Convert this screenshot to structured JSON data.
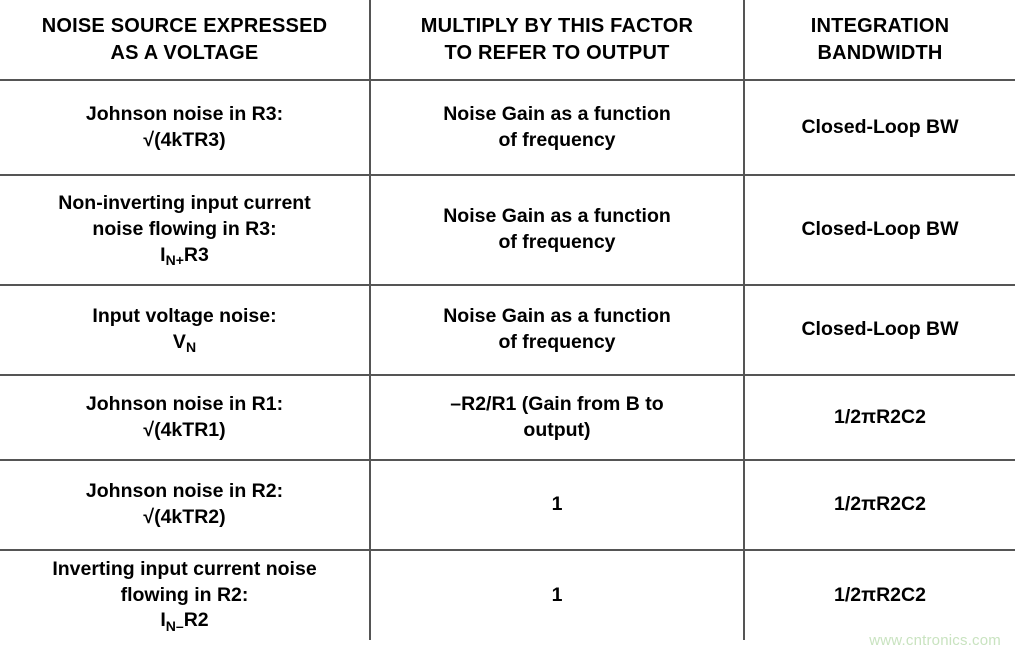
{
  "table": {
    "headers": [
      {
        "line1": "NOISE SOURCE EXPRESSED",
        "line2": "AS A VOLTAGE"
      },
      {
        "line1": "MULTIPLY BY THIS FACTOR",
        "line2": "TO REFER TO OUTPUT"
      },
      {
        "line1": "INTEGRATION",
        "line2": "BANDWIDTH"
      }
    ],
    "rows": [
      {
        "source_line1": "Johnson noise in R3:",
        "source_line2": "√(4kTR3)",
        "source_sub_base": "",
        "source_sub": "",
        "source_sub_tail": "",
        "factor_line1": "Noise Gain as a function",
        "factor_line2": "of frequency",
        "bandwidth": "Closed-Loop BW"
      },
      {
        "source_line1": "Non-inverting input current",
        "source_line2": "noise flowing in R3:",
        "source_sub_base": "I",
        "source_sub": "N+",
        "source_sub_tail": "R3",
        "factor_line1": "Noise Gain as a function",
        "factor_line2": "of frequency",
        "bandwidth": "Closed-Loop BW"
      },
      {
        "source_line1": "Input voltage noise:",
        "source_line2": "",
        "source_sub_base": "V",
        "source_sub": "N",
        "source_sub_tail": "",
        "factor_line1": "Noise Gain as a function",
        "factor_line2": "of frequency",
        "bandwidth": "Closed-Loop BW"
      },
      {
        "source_line1": "Johnson noise in R1:",
        "source_line2": "√(4kTR1)",
        "source_sub_base": "",
        "source_sub": "",
        "source_sub_tail": "",
        "factor_line1": "–R2/R1 (Gain from B to",
        "factor_line2": "output)",
        "bandwidth": "1/2πR2C2"
      },
      {
        "source_line1": "Johnson noise in R2:",
        "source_line2": "√(4kTR2)",
        "source_sub_base": "",
        "source_sub": "",
        "source_sub_tail": "",
        "factor_line1": "1",
        "factor_line2": "",
        "bandwidth": "1/2πR2C2"
      },
      {
        "source_line1": "Inverting input current noise",
        "source_line2": "flowing in R2:",
        "source_sub_base": "I",
        "source_sub": "N–",
        "source_sub_tail": "R2",
        "factor_line1": "1",
        "factor_line2": "",
        "bandwidth": "1/2πR2C2"
      }
    ]
  },
  "watermark": {
    "text": "www.cntronics.com",
    "color": "#c9e3c0"
  },
  "colors": {
    "border": "#555555",
    "text": "#000000",
    "background": "#ffffff"
  }
}
